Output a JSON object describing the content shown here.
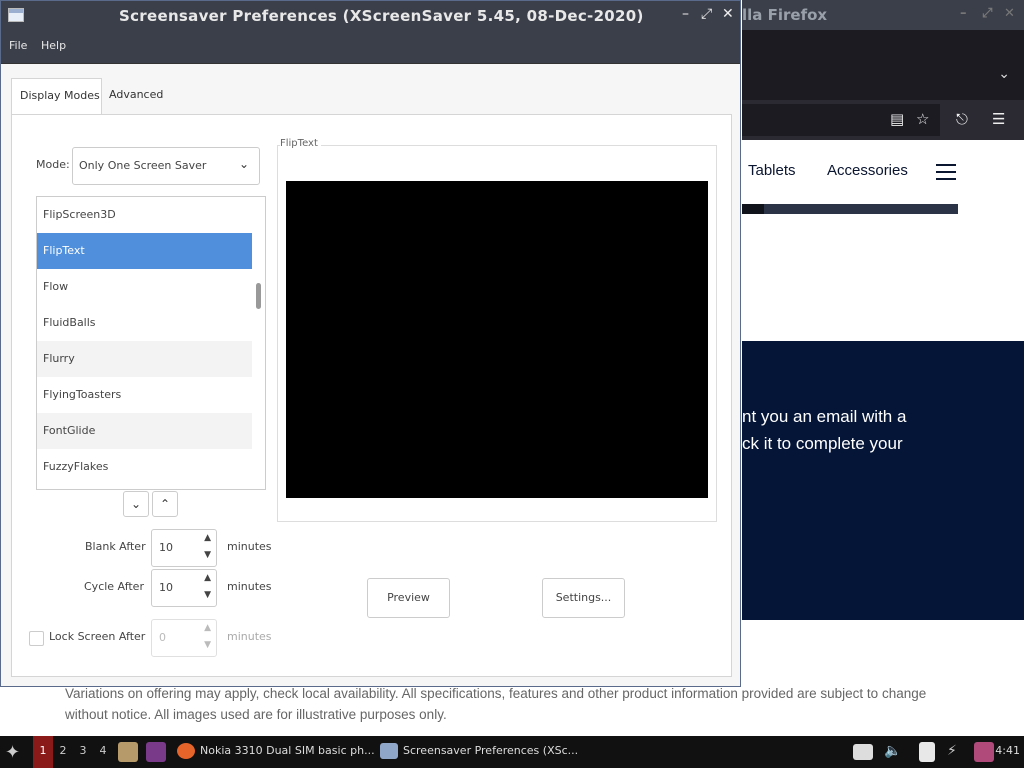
{
  "firefox": {
    "title": "lla Firefox",
    "menu": [
      "Tablets",
      "Accessories"
    ],
    "promo_line1": "nt you an email with a",
    "promo_line2": "ck it to complete your",
    "disclaimer_line1": "Variations on offering may apply, check local availability. All specifications, features and other product information provided are subject to change",
    "disclaimer_line2": "without notice. All images used are for illustrative purposes only."
  },
  "window": {
    "title": "Screensaver Preferences  (XScreenSaver 5.45, 08-Dec-2020)",
    "menu": [
      "File",
      "Help"
    ]
  },
  "tabs": [
    "Display Modes",
    "Advanced"
  ],
  "mode": {
    "label": "Mode:",
    "value": "Only One Screen Saver"
  },
  "list": {
    "items": [
      "FlipScreen3D",
      "FlipText",
      "Flow",
      "FluidBalls",
      "Flurry",
      "FlyingToasters",
      "FontGlide",
      "FuzzyFlakes"
    ],
    "selected": "FlipText"
  },
  "settings": {
    "blank_after": {
      "label": "Blank After",
      "value": "10",
      "unit": "minutes"
    },
    "cycle_after": {
      "label": "Cycle After",
      "value": "10",
      "unit": "minutes"
    },
    "lock_after": {
      "label": "Lock Screen After",
      "value": "0",
      "unit": "minutes",
      "checked": false
    }
  },
  "preview": {
    "frame_label": "FlipText",
    "preview_button": "Preview",
    "settings_button": "Settings..."
  },
  "taskbar": {
    "workspaces": [
      "1",
      "2",
      "3",
      "4"
    ],
    "tasks": [
      "Nokia 3310 Dual SIM basic ph...",
      "Screensaver Preferences  (XSc..."
    ],
    "clock": "4:41"
  }
}
